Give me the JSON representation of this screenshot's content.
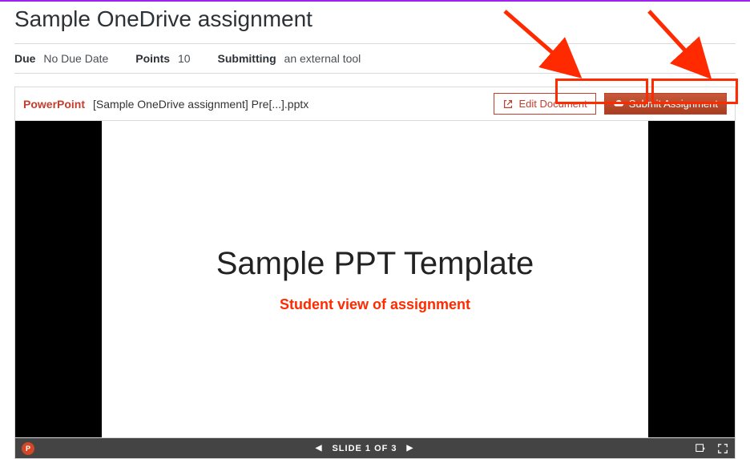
{
  "title": "Sample OneDrive assignment",
  "meta": {
    "due_label": "Due",
    "due_value": "No Due Date",
    "points_label": "Points",
    "points_value": "10",
    "submitting_label": "Submitting",
    "submitting_value": "an external tool"
  },
  "docbar": {
    "app": "PowerPoint",
    "filename": "[Sample OneDrive assignment] Pre[...].pptx",
    "edit_label": "Edit Document",
    "submit_label": "Submit Assignment"
  },
  "slide": {
    "title": "Sample PPT Template",
    "annotation": "Student view of assignment"
  },
  "statusbar": {
    "slide_text": "SLIDE 1 OF 3"
  }
}
